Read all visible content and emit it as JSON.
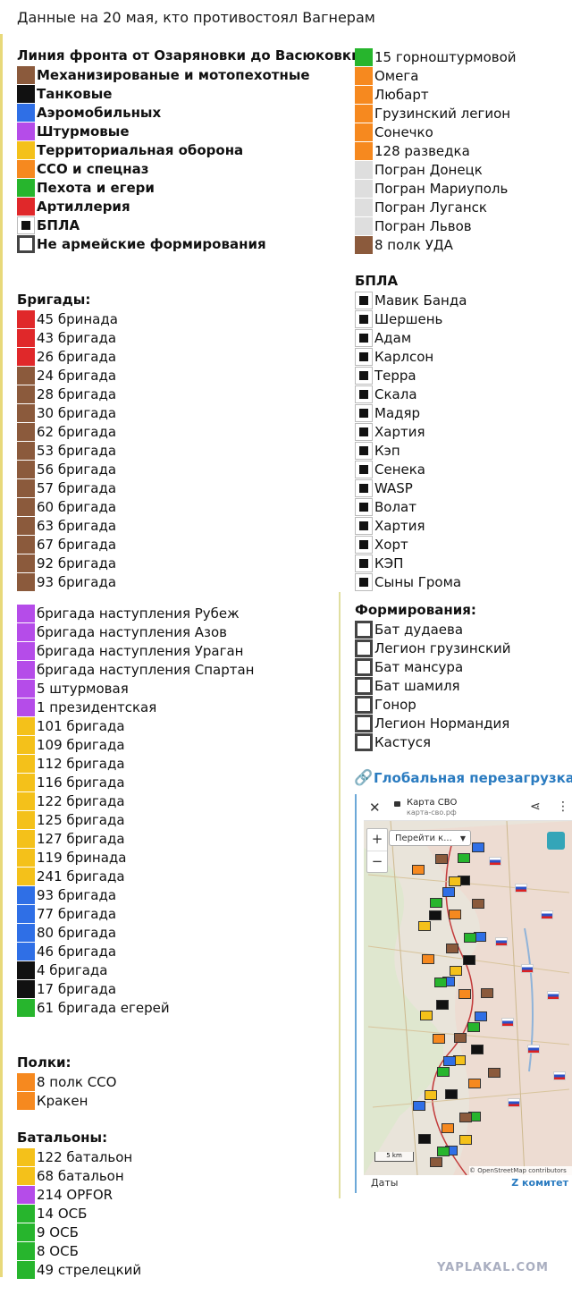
{
  "title": "Данные на 20 мая, кто противостоял Вагнерам",
  "colors": {
    "mech": "#8b5a3c",
    "tank": "#111111",
    "air": "#2f6fe6",
    "storm": "#b54ce9",
    "terr": "#f4c11a",
    "sso": "#f6891f",
    "inf": "#27b52d",
    "art": "#e0282a",
    "pogran": "#dedede",
    "bpla_fill": "#111111",
    "link": "#2a7bc0",
    "watermark": "#a9aec0"
  },
  "legend": {
    "header": "Линия фронта от Озаряновки до Васюковки:",
    "items": [
      {
        "label": "Механизированые и мотопехотные",
        "color": "#8b5a3c"
      },
      {
        "label": "Танковые",
        "color": "#111111"
      },
      {
        "label": "Аэромобильных",
        "color": "#2f6fe6"
      },
      {
        "label": "Штурмовые",
        "color": "#b54ce9"
      },
      {
        "label": "Территориальная оборона",
        "color": "#f4c11a"
      },
      {
        "label": "ССО и спецназ",
        "color": "#f6891f"
      },
      {
        "label": "Пехота и егери",
        "color": "#27b52d"
      },
      {
        "label": "Артиллерия",
        "color": "#e0282a"
      },
      {
        "label": "БПЛА",
        "icon": "black-square-icon"
      },
      {
        "label": "Не армейские формирования",
        "icon": "white-square-icon"
      }
    ]
  },
  "brigades": {
    "header": "Бригады:",
    "items": [
      {
        "label": "45 бринада",
        "color": "#e0282a"
      },
      {
        "label": "43 бригада",
        "color": "#e0282a"
      },
      {
        "label": "26 бригада",
        "color": "#e0282a"
      },
      {
        "label": "24 бригада",
        "color": "#8b5a3c"
      },
      {
        "label": "28 бригада",
        "color": "#8b5a3c"
      },
      {
        "label": "30 бригада",
        "color": "#8b5a3c"
      },
      {
        "label": "62 бригада",
        "color": "#8b5a3c"
      },
      {
        "label": "53 бригада",
        "color": "#8b5a3c"
      },
      {
        "label": "56 бригада",
        "color": "#8b5a3c"
      },
      {
        "label": "57 бригада",
        "color": "#8b5a3c"
      },
      {
        "label": "60 бригада",
        "color": "#8b5a3c"
      },
      {
        "label": "63 бригада",
        "color": "#8b5a3c"
      },
      {
        "label": "67 бригада",
        "color": "#8b5a3c"
      },
      {
        "label": "92 бригада",
        "color": "#8b5a3c"
      },
      {
        "label": "93 бригада",
        "color": "#8b5a3c"
      }
    ]
  },
  "brigades2": {
    "items": [
      {
        "label": "бригада наступления Рубеж",
        "color": "#b54ce9"
      },
      {
        "label": "бригада наступления Азов",
        "color": "#b54ce9"
      },
      {
        "label": "бригада наступления Ураган",
        "color": "#b54ce9"
      },
      {
        "label": "бригада наступления Спартан",
        "color": "#b54ce9"
      },
      {
        "label": "5 штурмовая",
        "color": "#b54ce9"
      },
      {
        "label": " 1 президентская",
        "color": "#b54ce9"
      },
      {
        "label": "101 бригада",
        "color": "#f4c11a"
      },
      {
        "label": "109 бригада",
        "color": "#f4c11a"
      },
      {
        "label": "112 бригада",
        "color": "#f4c11a"
      },
      {
        "label": "116 бригада",
        "color": "#f4c11a"
      },
      {
        "label": "122 бригада",
        "color": "#f4c11a"
      },
      {
        "label": "125 бригада",
        "color": "#f4c11a"
      },
      {
        "label": "127 бригада",
        "color": "#f4c11a"
      },
      {
        "label": "119 бринада",
        "color": "#f4c11a"
      },
      {
        "label": "241 бригада",
        "color": "#f4c11a"
      },
      {
        "label": "93 бригада",
        "color": "#2f6fe6"
      },
      {
        "label": "77 бригада",
        "color": "#2f6fe6"
      },
      {
        "label": "80 бригада",
        "color": "#2f6fe6"
      },
      {
        "label": "46 бригада",
        "color": "#2f6fe6"
      },
      {
        "label": "4 бригада",
        "color": "#111111"
      },
      {
        "label": "17 бригада",
        "color": "#111111"
      },
      {
        "label": "61 бригада егерей",
        "color": "#27b52d"
      }
    ]
  },
  "regiments": {
    "header": "Полки:",
    "items": [
      {
        "label": "8 полк ССО",
        "color": "#f6891f"
      },
      {
        "label": "Кракен",
        "color": "#f6891f"
      }
    ]
  },
  "battalions": {
    "header": "Батальоны:",
    "items": [
      {
        "label": "122 батальон",
        "color": "#f4c11a"
      },
      {
        "label": "68 батальон",
        "color": "#f4c11a"
      },
      {
        "label": "214 OPFOR",
        "color": "#b54ce9"
      },
      {
        "label": "14 ОСБ",
        "color": "#27b52d"
      },
      {
        "label": "9 ОСБ",
        "color": "#27b52d"
      },
      {
        "label": "8 ОСБ",
        "color": "#27b52d"
      },
      {
        "label": "49 стрелецкий",
        "color": "#27b52d"
      }
    ]
  },
  "units_right": {
    "items": [
      {
        "label": "15 горноштурмовой",
        "color": "#27b52d"
      },
      {
        "label": "Омега",
        "color": "#f6891f"
      },
      {
        "label": "Любарт",
        "color": "#f6891f"
      },
      {
        "label": "Грузинский легион",
        "color": "#f6891f"
      },
      {
        "label": "Сонечко",
        "color": "#f6891f"
      },
      {
        "label": "128 разведка",
        "color": "#f6891f"
      },
      {
        "label": "Погран Донецк",
        "color": "#dedede"
      },
      {
        "label": "Погран Мариуполь",
        "color": "#dedede"
      },
      {
        "label": "Погран Луганск",
        "color": "#dedede"
      },
      {
        "label": "Погран Львов",
        "color": "#dedede"
      },
      {
        "label": "8 полк УДА",
        "color": "#8b5a3c"
      }
    ]
  },
  "bpla": {
    "header": "БПЛА",
    "items": [
      "Мавик Банда",
      "Шершень",
      "Адам",
      "Карлсон",
      "Терра",
      "Скала",
      "Мадяр",
      "Хартия",
      "Кэп",
      "Сенека",
      "WASP",
      "Волат",
      "Хартия",
      "Хорт",
      "КЭП",
      "Сыны Грома"
    ]
  },
  "formations": {
    "header": "Формирования:",
    "items": [
      "Бат дудаева",
      "Легион грузинский",
      "Бат мансура",
      "Бат шамиля",
      "Гонор",
      "Легион Нормандия",
      "Кастуся"
    ]
  },
  "link": {
    "icon": "link-icon",
    "label": "Глобальная перезагрузка"
  },
  "map_card": {
    "title": "Карта СВО",
    "url": "карта-сво.рф",
    "goto_placeholder": "Перейти к...",
    "zoom_in": "+",
    "zoom_out": "−",
    "scale": "5 km",
    "attribution": "© OpenStreetMap contributors",
    "footer_left": "Даты",
    "footer_right": "Z комитет",
    "close": "✕",
    "share": "⋖",
    "menu": "⋮"
  },
  "watermark": "YAPLAKAL.COM"
}
